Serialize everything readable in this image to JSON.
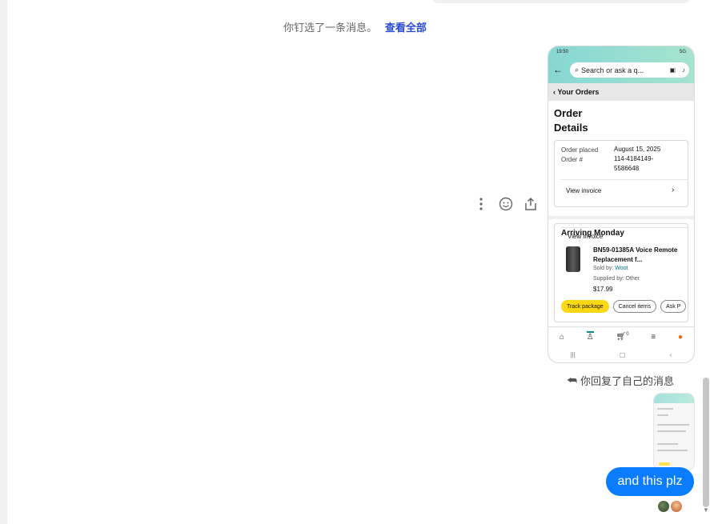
{
  "pinned_notice": {
    "text": "你钉选了一条消息。",
    "link": "查看全部"
  },
  "message_actions": [
    "more-options",
    "react",
    "share"
  ],
  "screenshot": {
    "status_time": "19:50",
    "status_right": "5G",
    "search_placeholder": "Search or ask a q...",
    "breadcrumb": "Your Orders",
    "page_title": "Order Details",
    "order_placed_label": "Order placed",
    "order_placed_value": "August 15, 2025",
    "order_number_label": "Order #",
    "order_number_value": "114-4184149-5586648",
    "view_invoice": "View invoice",
    "arriving": "Arriving Monday",
    "product_name": "BN59-01385A Voice Remote Replacement f...",
    "sold_by_label": "Sold by: ",
    "sold_by_value": "Woot",
    "supplied_by": "Supplied by: Other",
    "price": "$17.99",
    "buttons": [
      "Track package",
      "Cancel items",
      "Ask P"
    ],
    "cart_count": "0"
  },
  "reply_notice": "你回复了自己的消息",
  "message_bubble": "and this plz",
  "colors": {
    "bubble": "#0a7cff",
    "link": "#2a4bd8",
    "track_button": "#ffd814"
  }
}
